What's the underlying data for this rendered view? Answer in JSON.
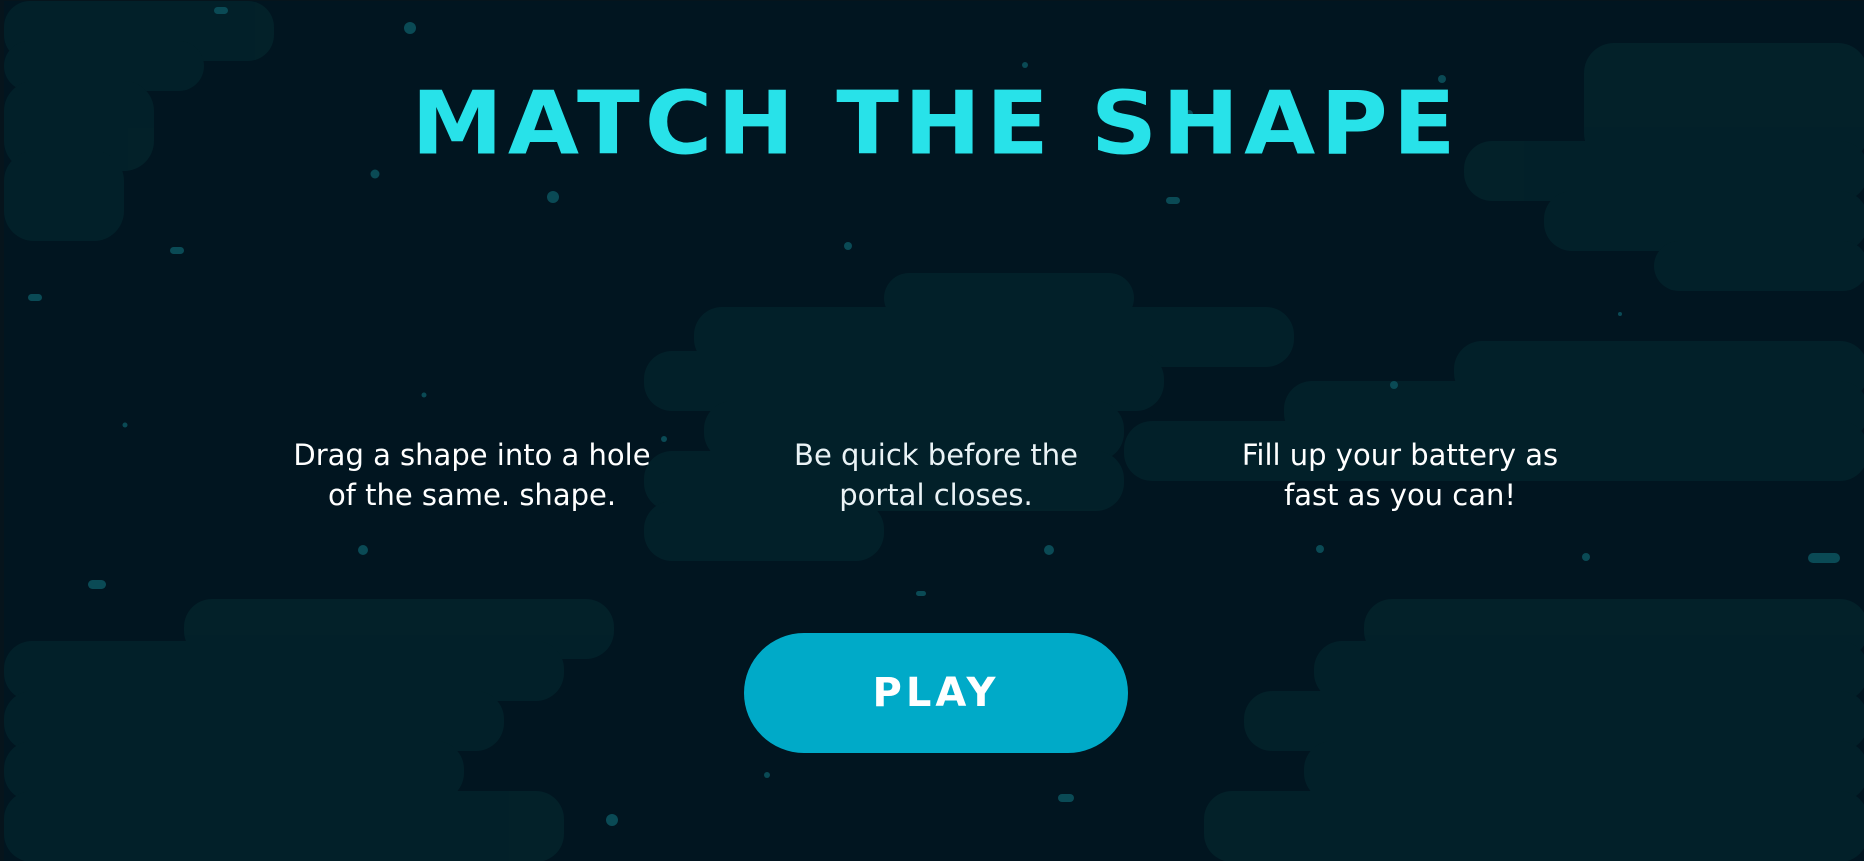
{
  "game": {
    "title": "MATCH THE SHAPE",
    "instructions": [
      "Drag a shape into a hole of the same. shape.",
      "Be quick before the portal closes.",
      "Fill up your battery as fast as you can!"
    ],
    "play_label": "PLAY"
  },
  "colors": {
    "background": "#011520",
    "title": "#28e2e9",
    "button": "#00aac8",
    "text": "#ffffff",
    "particles": "#0a4a55"
  }
}
